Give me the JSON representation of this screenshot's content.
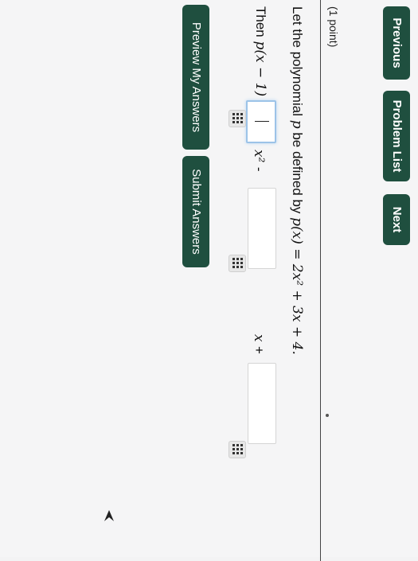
{
  "nav": {
    "previous": "Previous",
    "problem_list": "Problem List",
    "next": "Next"
  },
  "problem": {
    "points": "(1 point)",
    "prefix": "Let the polynomial ",
    "var_p": "p",
    "middle": " be defined by ",
    "definition": "p(x) = 2x² + 3x + 4.",
    "then_label": "Then ",
    "then_expr": "p(x − 1) =",
    "term1": "x²",
    "op1": "-",
    "term2": "x",
    "op2": "+"
  },
  "actions": {
    "preview": "Preview My Answers",
    "submit": "Submit Answers"
  },
  "icons": {
    "matrix": "grid-icon",
    "pointer": "pointer-arrow-icon"
  },
  "colors": {
    "button_bg": "#1f4f3f",
    "focus_border": "#9cc3e8"
  }
}
